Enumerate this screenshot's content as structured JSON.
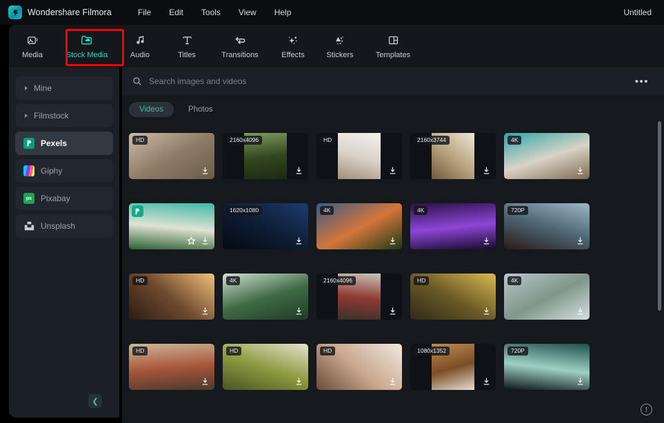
{
  "app": {
    "brand": "Wondershare Filmora",
    "logo_icon": "filmora-logo-icon",
    "document_title": "Untitled"
  },
  "menubar": {
    "items": [
      {
        "label": "File"
      },
      {
        "label": "Edit"
      },
      {
        "label": "Tools"
      },
      {
        "label": "View"
      },
      {
        "label": "Help"
      }
    ]
  },
  "tabs": {
    "active": "Stock Media",
    "highlight_color": "#ff0000",
    "active_color": "#2ed8c3",
    "items": [
      {
        "label": "Media",
        "icon": "image-card-icon"
      },
      {
        "label": "Stock Media",
        "icon": "folder-cloud-icon"
      },
      {
        "label": "Audio",
        "icon": "music-note-icon"
      },
      {
        "label": "Titles",
        "icon": "text-t-icon"
      },
      {
        "label": "Transitions",
        "icon": "transition-arrows-icon"
      },
      {
        "label": "Effects",
        "icon": "magic-wand-sparkle-icon"
      },
      {
        "label": "Stickers",
        "icon": "sticker-swirl-icon"
      },
      {
        "label": "Templates",
        "icon": "layout-panels-icon"
      }
    ]
  },
  "sidebar": {
    "selected": "Pexels",
    "collapse_icon": "chevron-left-icon",
    "items": [
      {
        "label": "Mine",
        "icon": "caret-right-icon",
        "type": "expandable"
      },
      {
        "label": "Filmstock",
        "icon": "caret-right-icon",
        "type": "expandable"
      },
      {
        "label": "Pexels",
        "icon": "pexels-logo-icon",
        "type": "source",
        "selected": true
      },
      {
        "label": "Giphy",
        "icon": "giphy-logo-icon",
        "type": "source"
      },
      {
        "label": "Pixabay",
        "icon": "pixabay-logo-icon",
        "type": "source"
      },
      {
        "label": "Unsplash",
        "icon": "unsplash-logo-icon",
        "type": "source"
      }
    ]
  },
  "search": {
    "placeholder": "Search images and videos",
    "value": "",
    "icon": "search-icon",
    "more_icon": "ellipsis-icon",
    "more_label": "•••"
  },
  "filters": {
    "active": "Videos",
    "items": [
      {
        "label": "Videos",
        "active": true
      },
      {
        "label": "Photos",
        "active": false
      }
    ]
  },
  "grid": {
    "download_icon": "download-icon",
    "favorite_icon": "star-icon",
    "items": [
      {
        "badge": "HD",
        "orientation": "landscape",
        "download": true,
        "favorite": false,
        "logo": false,
        "c1": "#cdbba6",
        "c2": "#8d7b66",
        "c3": "#6a5b4a"
      },
      {
        "badge": "2160x4096",
        "orientation": "portrait",
        "download": true,
        "favorite": false,
        "logo": false,
        "c1": "#7f9a5e",
        "c2": "#33471f",
        "c3": "#1d2912"
      },
      {
        "badge": "HD",
        "orientation": "portrait",
        "download": true,
        "favorite": false,
        "logo": false,
        "c1": "#f3f1ee",
        "c2": "#d9d2c7",
        "c3": "#a08e79"
      },
      {
        "badge": "2160x3744",
        "orientation": "portrait",
        "download": true,
        "favorite": false,
        "logo": false,
        "c1": "#efe6d6",
        "c2": "#b9a37f",
        "c3": "#6f5a3c"
      },
      {
        "badge": "4K",
        "orientation": "landscape",
        "download": true,
        "favorite": false,
        "logo": false,
        "c1": "#2fa6a8",
        "c2": "#d9d3c6",
        "c3": "#7d6a53"
      },
      {
        "badge": "",
        "orientation": "landscape",
        "download": true,
        "favorite": true,
        "logo": true,
        "c1": "#3fb8a6",
        "c2": "#dfe3d2",
        "c3": "#2d5f32"
      },
      {
        "badge": "1620x1080",
        "orientation": "landscape",
        "download": true,
        "favorite": false,
        "logo": false,
        "c1": "#1d3c6e",
        "c2": "#0d1c33",
        "c3": "#050a14"
      },
      {
        "badge": "4K",
        "orientation": "landscape",
        "download": true,
        "favorite": false,
        "logo": false,
        "c1": "#3b5a86",
        "c2": "#d4763a",
        "c3": "#1d3a16"
      },
      {
        "badge": "4K",
        "orientation": "landscape",
        "download": true,
        "favorite": false,
        "logo": false,
        "c1": "#2b1148",
        "c2": "#8d46d8",
        "c3": "#170a29"
      },
      {
        "badge": "720P",
        "orientation": "landscape",
        "download": true,
        "favorite": false,
        "logo": false,
        "c1": "#9fb6c4",
        "c2": "#4c6472",
        "c3": "#2c1a18"
      },
      {
        "badge": "HD",
        "orientation": "landscape",
        "download": true,
        "favorite": false,
        "logo": false,
        "c1": "#f0c07a",
        "c2": "#6e4a2e",
        "c3": "#2c1c12"
      },
      {
        "badge": "4K",
        "orientation": "landscape",
        "download": true,
        "favorite": false,
        "logo": false,
        "c1": "#cfe0d1",
        "c2": "#3f6a44",
        "c3": "#1f3b26"
      },
      {
        "badge": "2160x4096",
        "orientation": "portrait",
        "download": true,
        "favorite": false,
        "logo": false,
        "c1": "#c9c3b8",
        "c2": "#8f3a32",
        "c3": "#3a3028"
      },
      {
        "badge": "HD",
        "orientation": "landscape",
        "download": true,
        "favorite": false,
        "logo": false,
        "c1": "#d9ba52",
        "c2": "#6b5a26",
        "c3": "#2f2a18"
      },
      {
        "badge": "4K",
        "orientation": "landscape",
        "download": true,
        "favorite": false,
        "logo": false,
        "c1": "#b9c5cd",
        "c2": "#7f9789",
        "c3": "#d8dee2"
      },
      {
        "badge": "HD",
        "orientation": "landscape",
        "download": true,
        "favorite": false,
        "logo": false,
        "c1": "#cbb79a",
        "c2": "#a8563a",
        "c3": "#4a3a2c"
      },
      {
        "badge": "HD",
        "orientation": "landscape",
        "download": true,
        "favorite": false,
        "logo": false,
        "c1": "#e7e2cc",
        "c2": "#8c9a3f",
        "c3": "#4a5522"
      },
      {
        "badge": "HD",
        "orientation": "landscape",
        "download": true,
        "favorite": false,
        "logo": false,
        "c1": "#efe7df",
        "c2": "#caa98f",
        "c3": "#6b4b38"
      },
      {
        "badge": "1080x1352",
        "orientation": "portrait",
        "download": true,
        "favorite": false,
        "logo": false,
        "c1": "#c08b4f",
        "c2": "#7a4f26",
        "c3": "#e6ddcf"
      },
      {
        "badge": "720P",
        "orientation": "landscape",
        "download": true,
        "favorite": false,
        "logo": false,
        "c1": "#1f4f4a",
        "c2": "#9fd0c4",
        "c3": "#0a1416"
      }
    ]
  },
  "footer": {
    "info_icon": "alert-circle-icon",
    "info_label": "!"
  }
}
